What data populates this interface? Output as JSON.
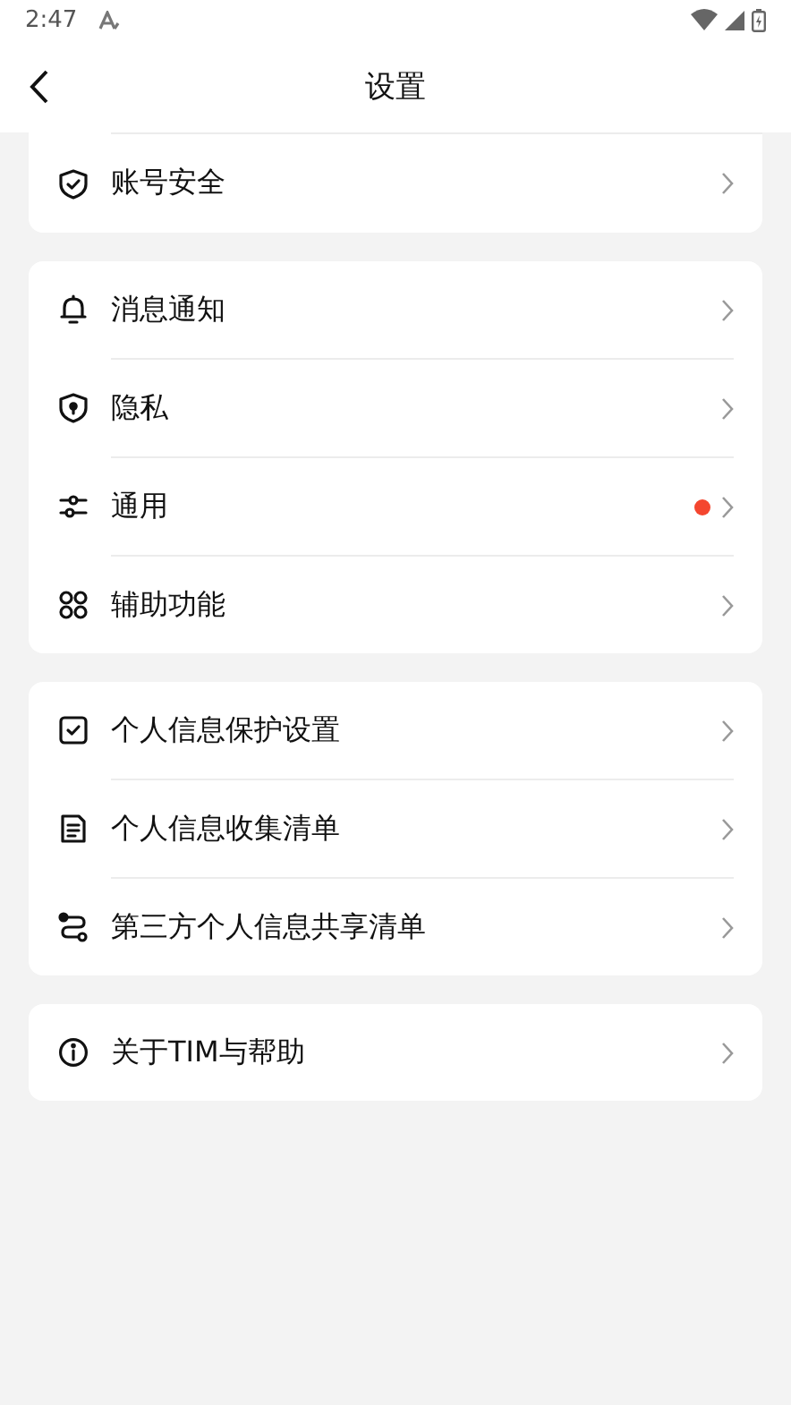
{
  "status_bar": {
    "time": "2:47"
  },
  "header": {
    "title": "设置"
  },
  "groups": [
    {
      "clipped_top": true,
      "items": [
        {
          "label": "账号安全",
          "badge": false
        }
      ]
    },
    {
      "clipped_top": false,
      "items": [
        {
          "label": "消息通知",
          "badge": false
        },
        {
          "label": "隐私",
          "badge": false
        },
        {
          "label": "通用",
          "badge": true
        },
        {
          "label": "辅助功能",
          "badge": false
        }
      ]
    },
    {
      "clipped_top": false,
      "items": [
        {
          "label": "个人信息保护设置",
          "badge": false
        },
        {
          "label": "个人信息收集清单",
          "badge": false
        },
        {
          "label": "第三方个人信息共享清单",
          "badge": false
        }
      ]
    },
    {
      "clipped_top": false,
      "items": [
        {
          "label": "关于TIM与帮助",
          "badge": false
        }
      ]
    }
  ]
}
